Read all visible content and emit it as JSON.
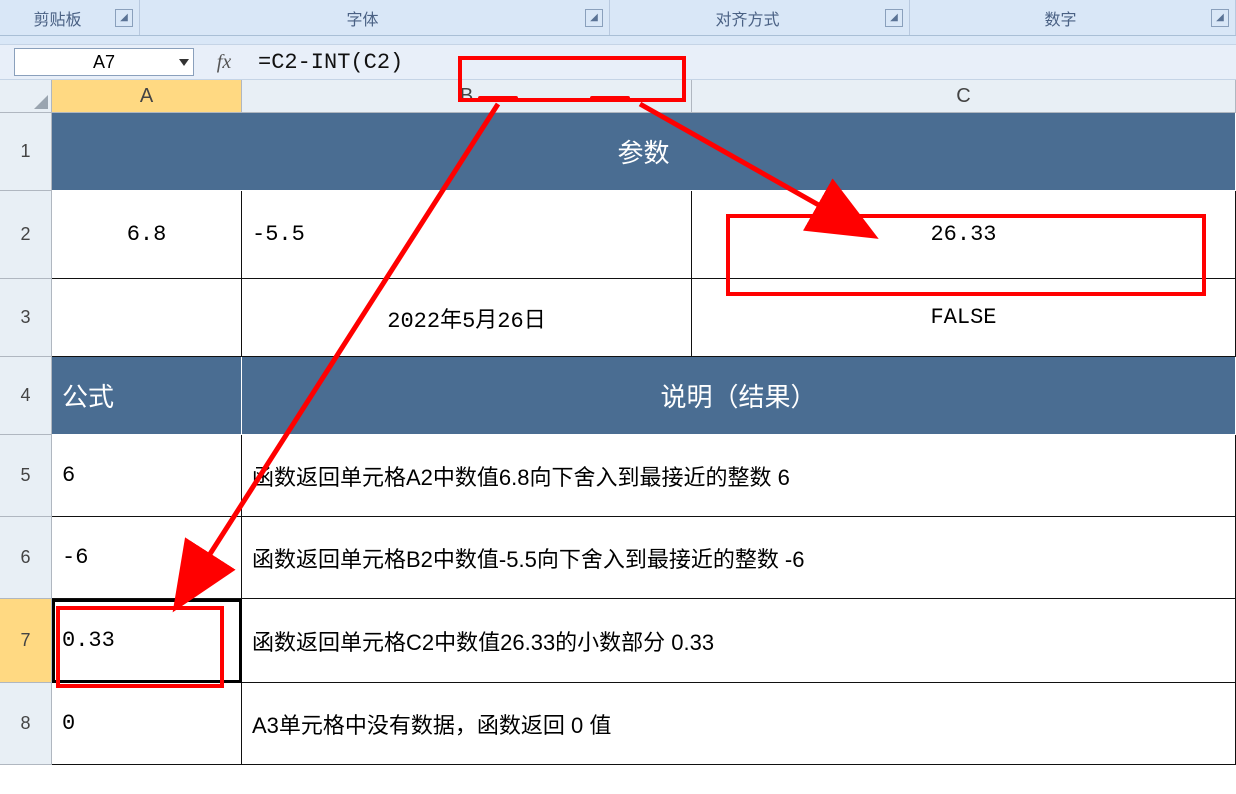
{
  "ribbon": {
    "clipboard": "剪贴板",
    "font": "字体",
    "alignment": "对齐方式",
    "number": "数字"
  },
  "formula_bar": {
    "name_box": "A7",
    "fx_label": "fx",
    "formula": "=C2-INT(C2)"
  },
  "columns": [
    "A",
    "B",
    "C"
  ],
  "rows": [
    "1",
    "2",
    "3",
    "4",
    "5",
    "6",
    "7",
    "8"
  ],
  "grid": {
    "header1": "参数",
    "r2": {
      "a": "6.8",
      "b": "-5.5",
      "c": "26.33"
    },
    "r3": {
      "a": "",
      "b": "2022年5月26日",
      "c": "FALSE"
    },
    "header4a": "公式",
    "header4bc": "说明（结果）",
    "r5": {
      "a": "6",
      "bc": "函数返回单元格A2中数值6.8向下舍入到最接近的整数 6"
    },
    "r6": {
      "a": "-6",
      "bc": "函数返回单元格B2中数值-5.5向下舍入到最接近的整数 -6"
    },
    "r7": {
      "a": "0.33",
      "bc": "函数返回单元格C2中数值26.33的小数部分 0.33"
    },
    "r8": {
      "a": "0",
      "bc": "A3单元格中没有数据，函数返回 0 值"
    }
  }
}
